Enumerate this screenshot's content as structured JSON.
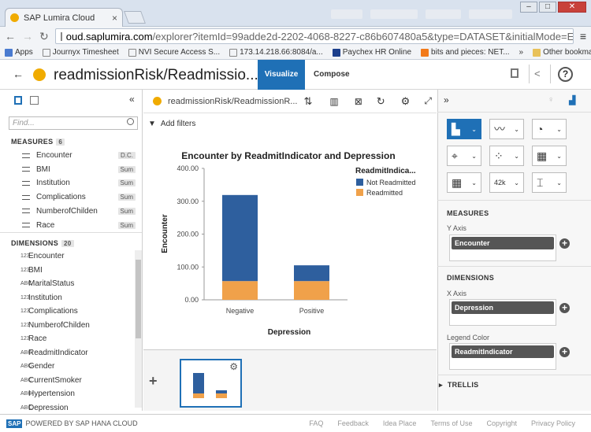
{
  "browser": {
    "tab_title": "SAP Lumira Cloud",
    "url_host": "oud.saplumira.com",
    "url_rest": "/explorer?itemId=99adde2d-2202-4068-8227-c86b607480a5&type=DATASET&initialMode=Explore",
    "bookmarks": [
      {
        "label": "Apps",
        "color": "#4a7bd0"
      },
      {
        "label": "Journyx Timesheet",
        "color": "#888888"
      },
      {
        "label": "NVI Secure Access S...",
        "color": "#888888"
      },
      {
        "label": "173.14.218.66:8084/a...",
        "color": "#888888"
      },
      {
        "label": "Paychex HR Online",
        "color": "#1c3f8c"
      },
      {
        "label": "bits and pieces: NET...",
        "color": "#f27a1a"
      }
    ],
    "more_bookmarks": "»",
    "other_bookmarks": "Other bookmarks"
  },
  "app": {
    "doc_title": "readmissionRisk/Readmissio...",
    "tabs": {
      "visualize": "Visualize",
      "compose": "Compose"
    }
  },
  "left": {
    "find_placeholder": "Find...",
    "measures_title": "MEASURES",
    "measures_count": "6",
    "measures": [
      {
        "label": "Encounter",
        "agg": "D.C."
      },
      {
        "label": "BMI",
        "agg": "Sum"
      },
      {
        "label": "Institution",
        "agg": "Sum"
      },
      {
        "label": "Complications",
        "agg": "Sum"
      },
      {
        "label": "NumberofChilden",
        "agg": "Sum"
      },
      {
        "label": "Race",
        "agg": "Sum"
      }
    ],
    "dimensions_title": "DIMENSIONS",
    "dimensions_count": "20",
    "dimensions": [
      {
        "type": "123",
        "label": "Encounter"
      },
      {
        "type": "123",
        "label": "BMI"
      },
      {
        "type": "ABC",
        "label": "MaritalStatus"
      },
      {
        "type": "123",
        "label": "Institution"
      },
      {
        "type": "123",
        "label": "Complications"
      },
      {
        "type": "123",
        "label": "NumberofChilden"
      },
      {
        "type": "123",
        "label": "Race"
      },
      {
        "type": "ABC",
        "label": "ReadmitIndicator"
      },
      {
        "type": "ABC",
        "label": "Gender"
      },
      {
        "type": "ABC",
        "label": "CurrentSmoker"
      },
      {
        "type": "ABC",
        "label": "Hypertension"
      },
      {
        "type": "ABC",
        "label": "Depression"
      }
    ]
  },
  "center": {
    "dataset_name": "readmissionRisk/ReadmissionR...",
    "add_filters": "Add filters"
  },
  "chart_data": {
    "type": "bar",
    "stacked": true,
    "title": "Encounter by ReadmitIndicator and Depression",
    "xlabel": "Depression",
    "ylabel": "Encounter",
    "categories": [
      "Negative",
      "Positive"
    ],
    "ylim": [
      0,
      400
    ],
    "yticks": [
      "0.00",
      "100.00",
      "200.00",
      "300.00",
      "400.00"
    ],
    "legend_title": "ReadmitIndica...",
    "legend_position": "top-right",
    "series": [
      {
        "name": "Not Readmitted",
        "color": "#2e5f9e",
        "values": [
          262,
          48
        ]
      },
      {
        "name": "Readmitted",
        "color": "#f0a14a",
        "values": [
          57,
          57
        ]
      }
    ]
  },
  "right": {
    "measures_title": "MEASURES",
    "y_axis_label": "Y Axis",
    "y_axis_value": "Encounter",
    "dimensions_title": "DIMENSIONS",
    "x_axis_label": "X Axis",
    "x_axis_value": "Depression",
    "legend_label": "Legend Color",
    "legend_value": "ReadmitIndicator",
    "trellis": "TRELLIS",
    "chart_buttons": [
      {
        "icon": "bar-chart-icon",
        "text": ""
      },
      {
        "icon": "line-chart-icon",
        "text": ""
      },
      {
        "icon": "pie-chart-icon",
        "text": ""
      },
      {
        "icon": "geo-map-icon",
        "text": ""
      },
      {
        "icon": "scatter-chart-icon",
        "text": ""
      },
      {
        "icon": "heatmap-icon",
        "text": ""
      },
      {
        "icon": "table-icon",
        "text": ""
      },
      {
        "icon": "numeric-point-icon",
        "text": "42k"
      },
      {
        "icon": "boxplot-icon",
        "text": ""
      }
    ]
  },
  "footer": {
    "powered_by": "POWERED BY SAP HANA CLOUD",
    "links": [
      "FAQ",
      "Feedback",
      "Idea Place",
      "Terms of Use",
      "Copyright",
      "Privacy Policy"
    ]
  }
}
